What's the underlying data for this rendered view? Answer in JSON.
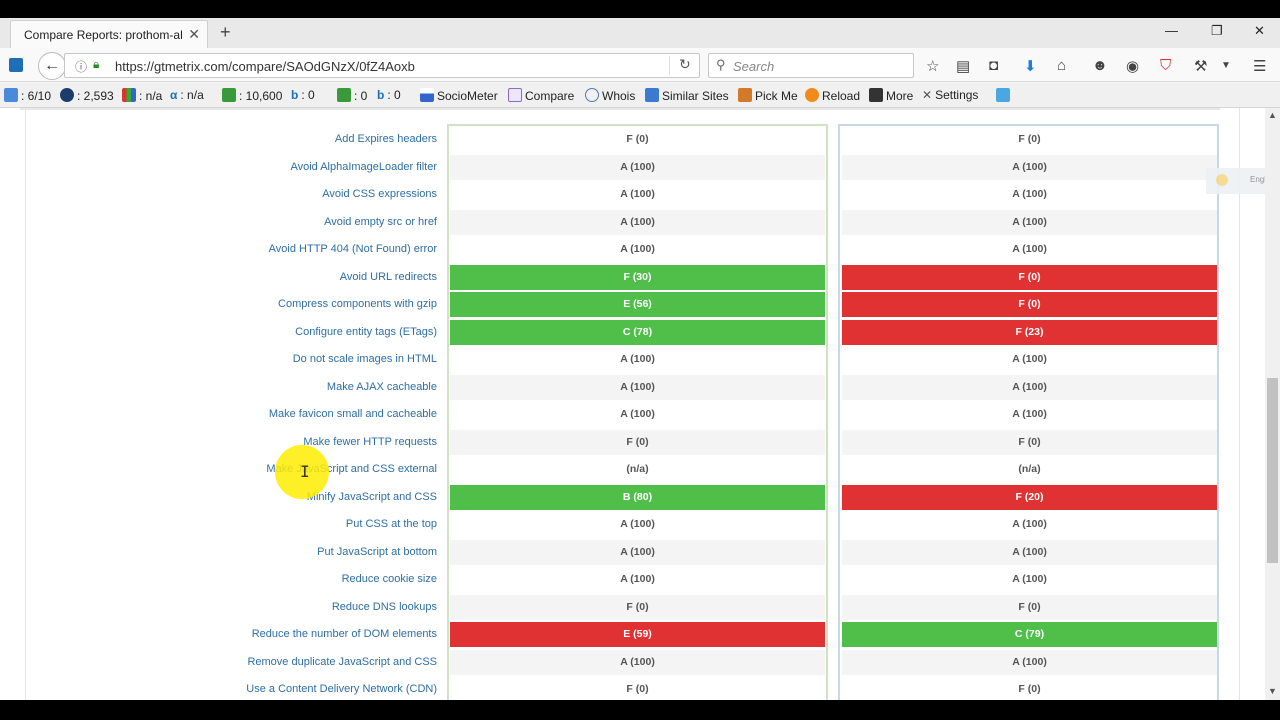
{
  "browser": {
    "tab_title": "Compare Reports: prothom-al…",
    "url": "https://gtmetrix.com/compare/SAOdGNzX/0fZ4Aoxb",
    "search_placeholder": "Search"
  },
  "toolbar": {
    "items": [
      {
        "label": ": 6/10",
        "icon": "google-pagerank-icon"
      },
      {
        "label": ": 2,593",
        "icon": "alexa-icon"
      },
      {
        "label": ": n/a",
        "icon": "stats-bars-icon"
      },
      {
        "label": ": n/a",
        "icon": "alpha-icon"
      },
      {
        "label": ": 10,600",
        "icon": "google-index-icon"
      },
      {
        "label": ": 0",
        "icon": "bing-icon"
      },
      {
        "label": ": 0",
        "icon": "google-index-icon"
      },
      {
        "label": ": 0",
        "icon": "bing-icon"
      },
      {
        "label": "SocioMeter",
        "icon": "sociometer-icon"
      },
      {
        "label": "Compare",
        "icon": "compare-icon"
      },
      {
        "label": "Whois",
        "icon": "whois-icon"
      },
      {
        "label": "Similar Sites",
        "icon": "similar-sites-icon"
      },
      {
        "label": "Pick Me",
        "icon": "pick-me-icon"
      },
      {
        "label": "Reload",
        "icon": "reload-icon"
      },
      {
        "label": "More",
        "icon": "more-icon"
      },
      {
        "label": "Settings",
        "icon": "settings-icon"
      }
    ]
  },
  "language_widget": {
    "label": "English"
  },
  "report": {
    "rows": [
      {
        "name": "Add Expires headers",
        "a": "F (0)",
        "b": "F (0)",
        "a_status": "plain",
        "b_status": "plain"
      },
      {
        "name": "Avoid AlphaImageLoader filter",
        "a": "A (100)",
        "b": "A (100)",
        "a_status": "plain",
        "b_status": "plain"
      },
      {
        "name": "Avoid CSS expressions",
        "a": "A (100)",
        "b": "A (100)",
        "a_status": "plain",
        "b_status": "plain"
      },
      {
        "name": "Avoid empty src or href",
        "a": "A (100)",
        "b": "A (100)",
        "a_status": "plain",
        "b_status": "plain"
      },
      {
        "name": "Avoid HTTP 404 (Not Found) error",
        "a": "A (100)",
        "b": "A (100)",
        "a_status": "plain",
        "b_status": "plain"
      },
      {
        "name": "Avoid URL redirects",
        "a": "F (30)",
        "b": "F (0)",
        "a_status": "green",
        "b_status": "red"
      },
      {
        "name": "Compress components with gzip",
        "a": "E (56)",
        "b": "F (0)",
        "a_status": "green",
        "b_status": "red"
      },
      {
        "name": "Configure entity tags (ETags)",
        "a": "C (78)",
        "b": "F (23)",
        "a_status": "green",
        "b_status": "red"
      },
      {
        "name": "Do not scale images in HTML",
        "a": "A (100)",
        "b": "A (100)",
        "a_status": "plain",
        "b_status": "plain"
      },
      {
        "name": "Make AJAX cacheable",
        "a": "A (100)",
        "b": "A (100)",
        "a_status": "plain",
        "b_status": "plain"
      },
      {
        "name": "Make favicon small and cacheable",
        "a": "A (100)",
        "b": "A (100)",
        "a_status": "plain",
        "b_status": "plain"
      },
      {
        "name": "Make fewer HTTP requests",
        "a": "F (0)",
        "b": "F (0)",
        "a_status": "plain",
        "b_status": "plain"
      },
      {
        "name": "Make JavaScript and CSS external",
        "a": "(n/a)",
        "b": "(n/a)",
        "a_status": "plain",
        "b_status": "plain"
      },
      {
        "name": "Minify JavaScript and CSS",
        "a": "B (80)",
        "b": "F (20)",
        "a_status": "green",
        "b_status": "red"
      },
      {
        "name": "Put CSS at the top",
        "a": "A (100)",
        "b": "A (100)",
        "a_status": "plain",
        "b_status": "plain"
      },
      {
        "name": "Put JavaScript at bottom",
        "a": "A (100)",
        "b": "A (100)",
        "a_status": "plain",
        "b_status": "plain"
      },
      {
        "name": "Reduce cookie size",
        "a": "A (100)",
        "b": "A (100)",
        "a_status": "plain",
        "b_status": "plain"
      },
      {
        "name": "Reduce DNS lookups",
        "a": "F (0)",
        "b": "F (0)",
        "a_status": "plain",
        "b_status": "plain"
      },
      {
        "name": "Reduce the number of DOM elements",
        "a": "E (59)",
        "b": "C (79)",
        "a_status": "red",
        "b_status": "green"
      },
      {
        "name": "Remove duplicate JavaScript and CSS",
        "a": "A (100)",
        "b": "A (100)",
        "a_status": "plain",
        "b_status": "plain"
      },
      {
        "name": "Use a Content Delivery Network (CDN)",
        "a": "F (0)",
        "b": "F (0)",
        "a_status": "plain",
        "b_status": "plain"
      }
    ]
  }
}
